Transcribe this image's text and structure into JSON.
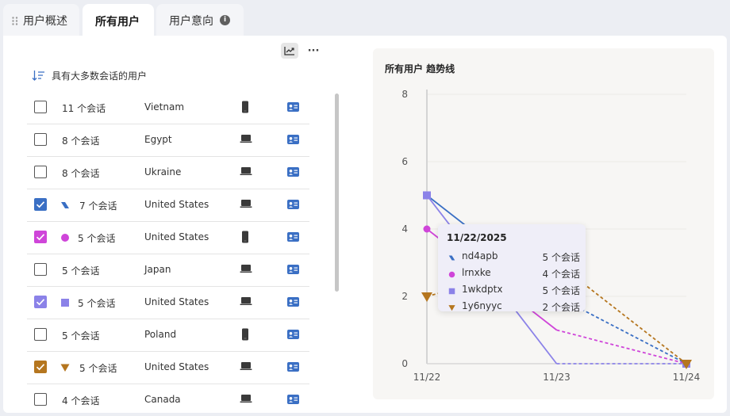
{
  "tabs": [
    {
      "label": "用户概述",
      "active": false
    },
    {
      "label": "所有用户",
      "active": true
    },
    {
      "label": "用户意向",
      "active": false,
      "has_info_icon": true
    }
  ],
  "toolbar": {
    "chart_icon": "chart-trend-icon",
    "more_label": "···"
  },
  "list": {
    "sort_label": "具有大多数会话的用户",
    "rows": [
      {
        "checked": false,
        "marker": "none",
        "sessions": "11 个会话",
        "country": "Vietnam",
        "device": "mobile",
        "color": ""
      },
      {
        "checked": false,
        "marker": "none",
        "sessions": "8 个会话",
        "country": "Egypt",
        "device": "desktop",
        "color": ""
      },
      {
        "checked": false,
        "marker": "none",
        "sessions": "8 个会话",
        "country": "Ukraine",
        "device": "desktop",
        "color": ""
      },
      {
        "checked": true,
        "marker": "parallelogram",
        "sessions": "7 个会话",
        "country": "United States",
        "device": "desktop",
        "color": "#3a6fc4"
      },
      {
        "checked": true,
        "marker": "circle",
        "sessions": "5 个会话",
        "country": "United States",
        "device": "mobile",
        "color": "#cf45d9"
      },
      {
        "checked": false,
        "marker": "none",
        "sessions": "5 个会话",
        "country": "Japan",
        "device": "desktop",
        "color": ""
      },
      {
        "checked": true,
        "marker": "square",
        "sessions": "5 个会话",
        "country": "United States",
        "device": "desktop",
        "color": "#8b82e8"
      },
      {
        "checked": false,
        "marker": "none",
        "sessions": "5 个会话",
        "country": "Poland",
        "device": "mobile",
        "color": ""
      },
      {
        "checked": true,
        "marker": "triangle",
        "sessions": "5 个会话",
        "country": "United States",
        "device": "desktop",
        "color": "#b5761f"
      },
      {
        "checked": false,
        "marker": "none",
        "sessions": "4 个会话",
        "country": "Canada",
        "device": "desktop",
        "color": ""
      }
    ]
  },
  "tooltip": {
    "date": "11/22/2025",
    "rows": [
      {
        "name": "nd4apb",
        "value": "5 个会话",
        "marker": "parallelogram",
        "color": "#3a6fc4"
      },
      {
        "name": "lrnxke",
        "value": "4 个会话",
        "marker": "circle",
        "color": "#cf45d9"
      },
      {
        "name": "1wkdptx",
        "value": "5 个会话",
        "marker": "square",
        "color": "#8b82e8"
      },
      {
        "name": "1y6nyyc",
        "value": "2 个会话",
        "marker": "triangle",
        "color": "#b5761f"
      }
    ]
  },
  "chart_data": {
    "type": "line",
    "title": "所有用户 趋势线",
    "x": [
      "11/22",
      "11/23",
      "11/24"
    ],
    "ylim": [
      0,
      8
    ],
    "yticks": [
      0,
      2,
      4,
      6,
      8
    ],
    "grid": true,
    "series": [
      {
        "name": "nd4apb",
        "values": [
          5,
          2,
          0
        ],
        "color": "#3a6fc4",
        "marker": "parallelogram"
      },
      {
        "name": "lrnxke",
        "values": [
          4,
          1,
          0
        ],
        "color": "#cf45d9",
        "marker": "circle"
      },
      {
        "name": "1wkdptx",
        "values": [
          5,
          0,
          0
        ],
        "color": "#8b82e8",
        "marker": "square"
      },
      {
        "name": "1y6nyyc",
        "values": [
          2,
          3,
          0
        ],
        "color": "#b5761f",
        "marker": "triangle"
      }
    ]
  }
}
